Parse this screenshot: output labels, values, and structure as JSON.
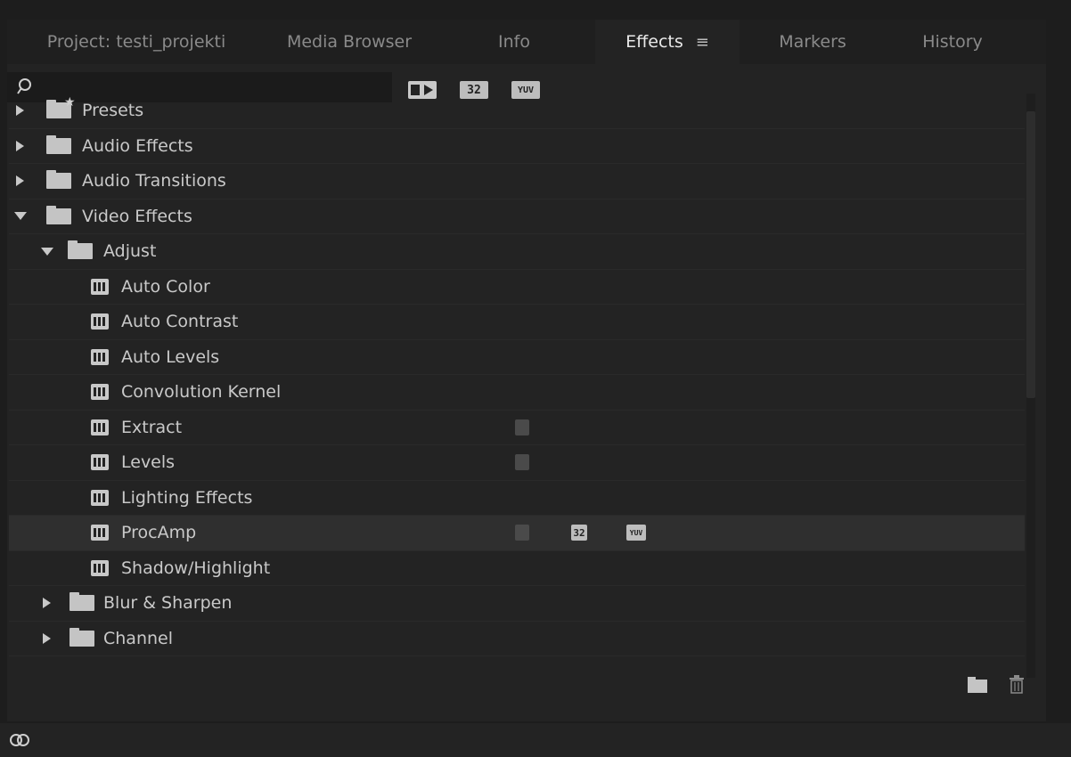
{
  "tabs": [
    {
      "label": "Project: testi_projekti"
    },
    {
      "label": "Media Browser"
    },
    {
      "label": "Info"
    },
    {
      "label": "Effects"
    },
    {
      "label": "Markers"
    },
    {
      "label": "History"
    }
  ],
  "toolbar": {
    "search_value": "",
    "buttons": [
      {
        "name": "accelerated-effects-filter",
        "label": ""
      },
      {
        "name": "32-bit-color-filter",
        "label": "32"
      },
      {
        "name": "yuv-effects-filter",
        "label": "YUV"
      }
    ]
  },
  "tree": [
    {
      "label": "Presets"
    },
    {
      "label": "Audio Effects"
    },
    {
      "label": "Audio Transitions"
    },
    {
      "label": "Video Effects"
    },
    {
      "label": "Adjust"
    },
    {
      "label": "Auto Color"
    },
    {
      "label": "Auto Contrast"
    },
    {
      "label": "Auto Levels"
    },
    {
      "label": "Convolution Kernel"
    },
    {
      "label": "Extract"
    },
    {
      "label": "Levels"
    },
    {
      "label": "Lighting Effects"
    },
    {
      "label": "ProcAmp"
    },
    {
      "label": "Shadow/Highlight"
    },
    {
      "label": "Blur & Sharpen"
    },
    {
      "label": "Channel"
    }
  ],
  "badges": {
    "b32": "32",
    "yuv": "YUV"
  },
  "colors": {
    "panel_bg": "#232323",
    "selected_row": "#2f2f2f",
    "text": "#c9c9c9"
  }
}
